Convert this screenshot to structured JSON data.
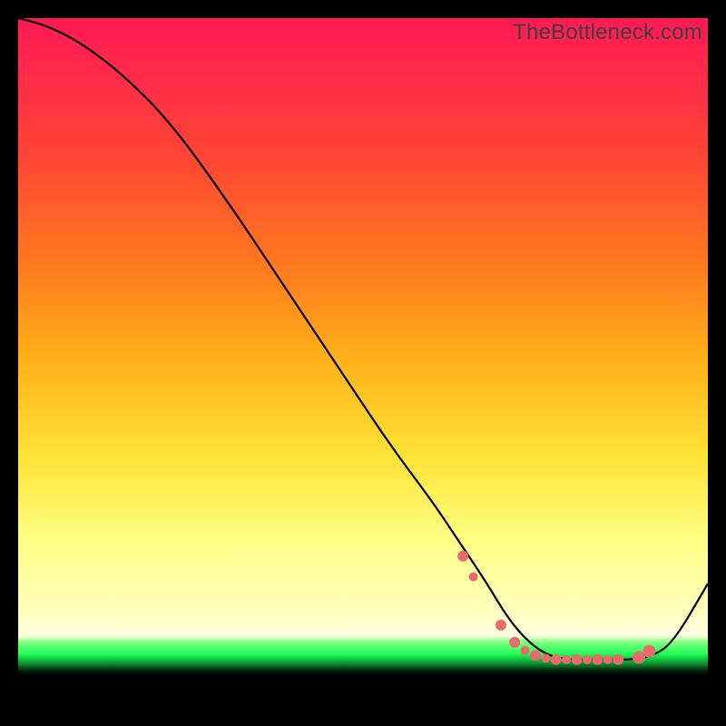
{
  "watermark": "TheBottleneck.com",
  "colors": {
    "background": "#000000",
    "curve_stroke": "#000000",
    "marker_fill": "#e86a6a",
    "gradient_stops": [
      "#ff1a55",
      "#ff2a4a",
      "#ff4534",
      "#ff7a1e",
      "#ffb31a",
      "#ffe438",
      "#ffff86",
      "#ffffc0",
      "#ffffe2",
      "#7fff7f",
      "#1dff55",
      "#0a8f2f",
      "#04250e",
      "#000000"
    ]
  },
  "chart_data": {
    "type": "line",
    "title": "",
    "xlabel": "",
    "ylabel": "",
    "xlim": [
      0,
      100
    ],
    "ylim": [
      0,
      100
    ],
    "series": [
      {
        "name": "curve",
        "x": [
          0,
          4,
          9,
          15,
          22,
          30,
          38,
          46,
          54,
          60,
          64,
          68,
          71,
          74,
          77,
          80,
          83,
          86,
          89,
          92,
          95,
          100
        ],
        "y": [
          100,
          99,
          96.5,
          92,
          85,
          74,
          62,
          50,
          38,
          30,
          24,
          18,
          13,
          9.5,
          7.5,
          7,
          7,
          7,
          7,
          7.5,
          9.5,
          18
        ]
      }
    ],
    "markers": {
      "name": "highlighted-points",
      "x": [
        64.5,
        66,
        70,
        72,
        73.5,
        75,
        76.5,
        78,
        79.5,
        81,
        82.5,
        84,
        85.5,
        87,
        90,
        91.5
      ],
      "y": [
        22,
        19,
        12,
        9.5,
        8.3,
        7.6,
        7.2,
        7,
        7,
        7,
        7,
        7,
        7,
        7,
        7.3,
        8.2
      ],
      "r": [
        6,
        5,
        6,
        6,
        5,
        6,
        5,
        6,
        5,
        6,
        5,
        6,
        5,
        6,
        7,
        7
      ]
    }
  }
}
